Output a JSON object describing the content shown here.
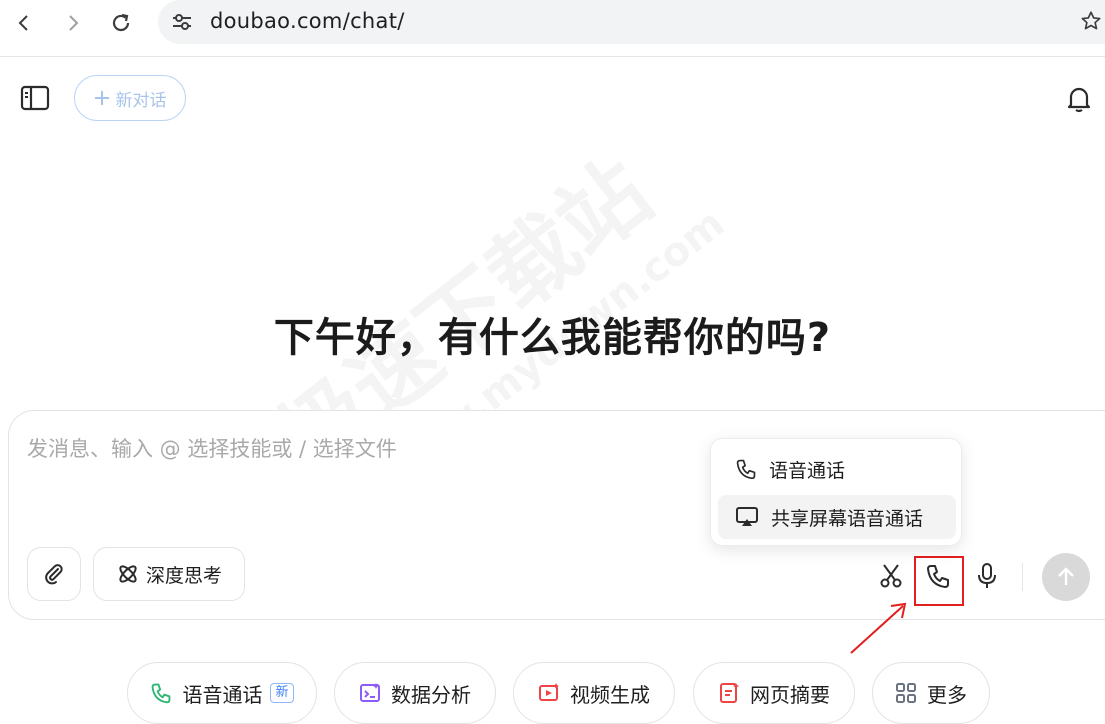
{
  "browser": {
    "url": "doubao.com/chat/"
  },
  "header": {
    "new_chat_label": "新对话"
  },
  "main": {
    "greeting": "下午好，有什么我能帮你的吗?"
  },
  "composer": {
    "placeholder": "发消息、输入 @ 选择技能或 / 选择文件",
    "deep_think_label": "深度思考"
  },
  "call_menu": {
    "items": [
      {
        "label": "语音通话",
        "icon": "phone-icon"
      },
      {
        "label": "共享屏幕语音通话",
        "icon": "screen-share-icon"
      }
    ]
  },
  "chips": [
    {
      "label": "语音通话",
      "badge": "新",
      "icon": "phone-icon",
      "color": "#2bb673"
    },
    {
      "label": "数据分析",
      "icon": "data-analysis-icon",
      "color": "#8b5cf6"
    },
    {
      "label": "视频生成",
      "icon": "video-icon",
      "color": "#ef4444"
    },
    {
      "label": "网页摘要",
      "icon": "web-summary-icon",
      "color": "#ef4444"
    },
    {
      "label": "更多",
      "icon": "more-grid-icon",
      "color": "#6b7280"
    }
  ],
  "watermark": {
    "line1": "极速下载站",
    "line2": "www.mydown.com"
  },
  "colors": {
    "highlight": "#e11f1f",
    "accent_blue": "#3b82f6"
  }
}
